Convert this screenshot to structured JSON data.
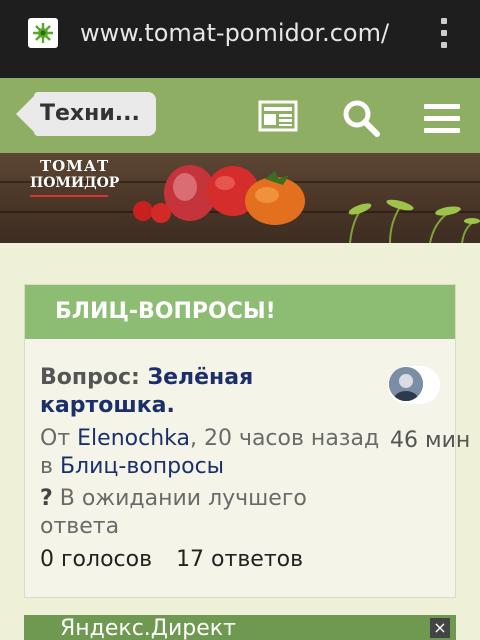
{
  "browser": {
    "url": "www.tomat-pomidor.com/",
    "favicon": "site-favicon",
    "menu_icon": "kebab-menu-icon"
  },
  "header": {
    "back_label": "Техни...",
    "icons": [
      "news-icon",
      "search-icon",
      "hamburger-menu-icon"
    ],
    "bg_color": "#8dae63"
  },
  "banner": {
    "logo_line1": "ТОМАТ",
    "logo_line2": "ПОМИДОР"
  },
  "card": {
    "header_title": "БЛИЦ-ВОПРОСЫ!",
    "question_prefix": "Вопрос:",
    "question_title": "Зелёная картошка.",
    "by_label": "От",
    "author": "Elenochka",
    "time_ago": ", 20 часов назад в",
    "category": "Блиц-вопросы",
    "status_icon": "?",
    "status_text": "В ожидании лучшего ответа",
    "votes": "0 голосов",
    "answers": "17 ответов",
    "activity_time": "46 мин"
  },
  "ad": {
    "label": "Яндекс.Директ",
    "close": "×"
  }
}
